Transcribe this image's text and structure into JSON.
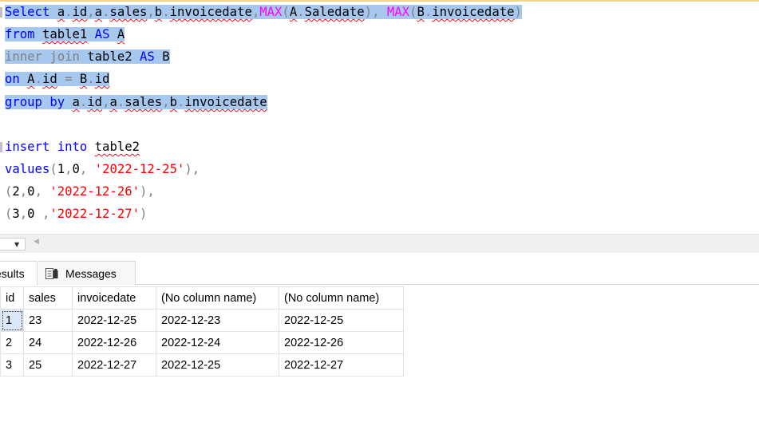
{
  "editor": {
    "lines": [
      [
        {
          "t": "Select ",
          "c": "kw"
        },
        {
          "t": "a",
          "c": "tx"
        },
        {
          "t": ".",
          "c": "gr"
        },
        {
          "t": "id",
          "c": "tx"
        },
        {
          "t": ",",
          "c": "gr"
        },
        {
          "t": "a",
          "c": "tx"
        },
        {
          "t": ".",
          "c": "gr"
        },
        {
          "t": "sales",
          "c": "tx"
        },
        {
          "t": ",",
          "c": "gr"
        },
        {
          "t": "b",
          "c": "tx"
        },
        {
          "t": ".",
          "c": "gr"
        },
        {
          "t": "invoicedate",
          "c": "tx"
        },
        {
          "t": ",",
          "c": "gr"
        },
        {
          "t": "MAX",
          "c": "fn"
        },
        {
          "t": "(",
          "c": "gr"
        },
        {
          "t": "A",
          "c": "tx"
        },
        {
          "t": ".",
          "c": "gr"
        },
        {
          "t": "Saledate",
          "c": "tx"
        },
        {
          "t": "), ",
          "c": "gr"
        },
        {
          "t": "MAX",
          "c": "fn"
        },
        {
          "t": "(",
          "c": "gr"
        },
        {
          "t": "B",
          "c": "tx"
        },
        {
          "t": ".",
          "c": "gr"
        },
        {
          "t": "invoicedate",
          "c": "tx"
        },
        {
          "t": ")",
          "c": "gr"
        }
      ],
      [
        {
          "t": "from ",
          "c": "kw"
        },
        {
          "t": "table1",
          "c": "tx"
        },
        {
          "t": " AS ",
          "c": "kw"
        },
        {
          "t": "A",
          "c": "tx"
        }
      ],
      [
        {
          "t": "inner join ",
          "c": "gr"
        },
        {
          "t": "table2",
          "c": "tx"
        },
        {
          "t": " AS ",
          "c": "kw"
        },
        {
          "t": "B",
          "c": "tx"
        }
      ],
      [
        {
          "t": "on ",
          "c": "kw"
        },
        {
          "t": "A",
          "c": "tx"
        },
        {
          "t": ".",
          "c": "gr"
        },
        {
          "t": "id",
          "c": "tx"
        },
        {
          "t": " = ",
          "c": "gr"
        },
        {
          "t": "B",
          "c": "tx"
        },
        {
          "t": ".",
          "c": "gr"
        },
        {
          "t": "id",
          "c": "tx"
        }
      ],
      [
        {
          "t": "group by ",
          "c": "kw"
        },
        {
          "t": "a",
          "c": "tx"
        },
        {
          "t": ".",
          "c": "gr"
        },
        {
          "t": "id",
          "c": "tx"
        },
        {
          "t": ",",
          "c": "gr"
        },
        {
          "t": "a",
          "c": "tx"
        },
        {
          "t": ".",
          "c": "gr"
        },
        {
          "t": "sales",
          "c": "tx"
        },
        {
          "t": ",",
          "c": "gr"
        },
        {
          "t": "b",
          "c": "tx"
        },
        {
          "t": ".",
          "c": "gr"
        },
        {
          "t": "invoicedate",
          "c": "tx"
        }
      ],
      [],
      [
        {
          "t": "insert into ",
          "c": "kw"
        },
        {
          "t": "table2",
          "c": "tx"
        }
      ],
      [
        {
          "t": "values",
          "c": "kw"
        },
        {
          "t": "(",
          "c": "gr"
        },
        {
          "t": "1",
          "c": "tx"
        },
        {
          "t": ",",
          "c": "gr"
        },
        {
          "t": "0",
          "c": "tx"
        },
        {
          "t": ", ",
          "c": "gr"
        },
        {
          "t": "'2022-12-25'",
          "c": "st"
        },
        {
          "t": "),",
          "c": "gr"
        }
      ],
      [
        {
          "t": "(",
          "c": "gr"
        },
        {
          "t": "2",
          "c": "tx"
        },
        {
          "t": ",",
          "c": "gr"
        },
        {
          "t": "0",
          "c": "tx"
        },
        {
          "t": ", ",
          "c": "gr"
        },
        {
          "t": "'2022-12-26'",
          "c": "st"
        },
        {
          "t": "),",
          "c": "gr"
        }
      ],
      [
        {
          "t": "(",
          "c": "gr"
        },
        {
          "t": "3",
          "c": "tx"
        },
        {
          "t": ",",
          "c": "gr"
        },
        {
          "t": "0",
          "c": "tx"
        },
        {
          "t": " ,",
          "c": "gr"
        },
        {
          "t": "'2022-12-27'",
          "c": "st"
        },
        {
          "t": ")",
          "c": "gr"
        }
      ]
    ]
  },
  "tabs": {
    "results_label": "esults",
    "messages_label": "Messages"
  },
  "grid": {
    "columns": [
      "id",
      "sales",
      "invoicedate",
      "(No column name)",
      "(No column name)"
    ],
    "rows": [
      [
        "1",
        "23",
        "2022-12-25",
        "2022-12-23",
        "2022-12-25"
      ],
      [
        "2",
        "24",
        "2022-12-26",
        "2022-12-24",
        "2022-12-26"
      ],
      [
        "3",
        "25",
        "2022-12-27",
        "2022-12-25",
        "2022-12-27"
      ]
    ]
  },
  "colors": {
    "selection": "#a6c8ef",
    "keyword": "#0000ff",
    "function": "#ff00ff",
    "string": "#ff0000",
    "operator": "#808080"
  }
}
